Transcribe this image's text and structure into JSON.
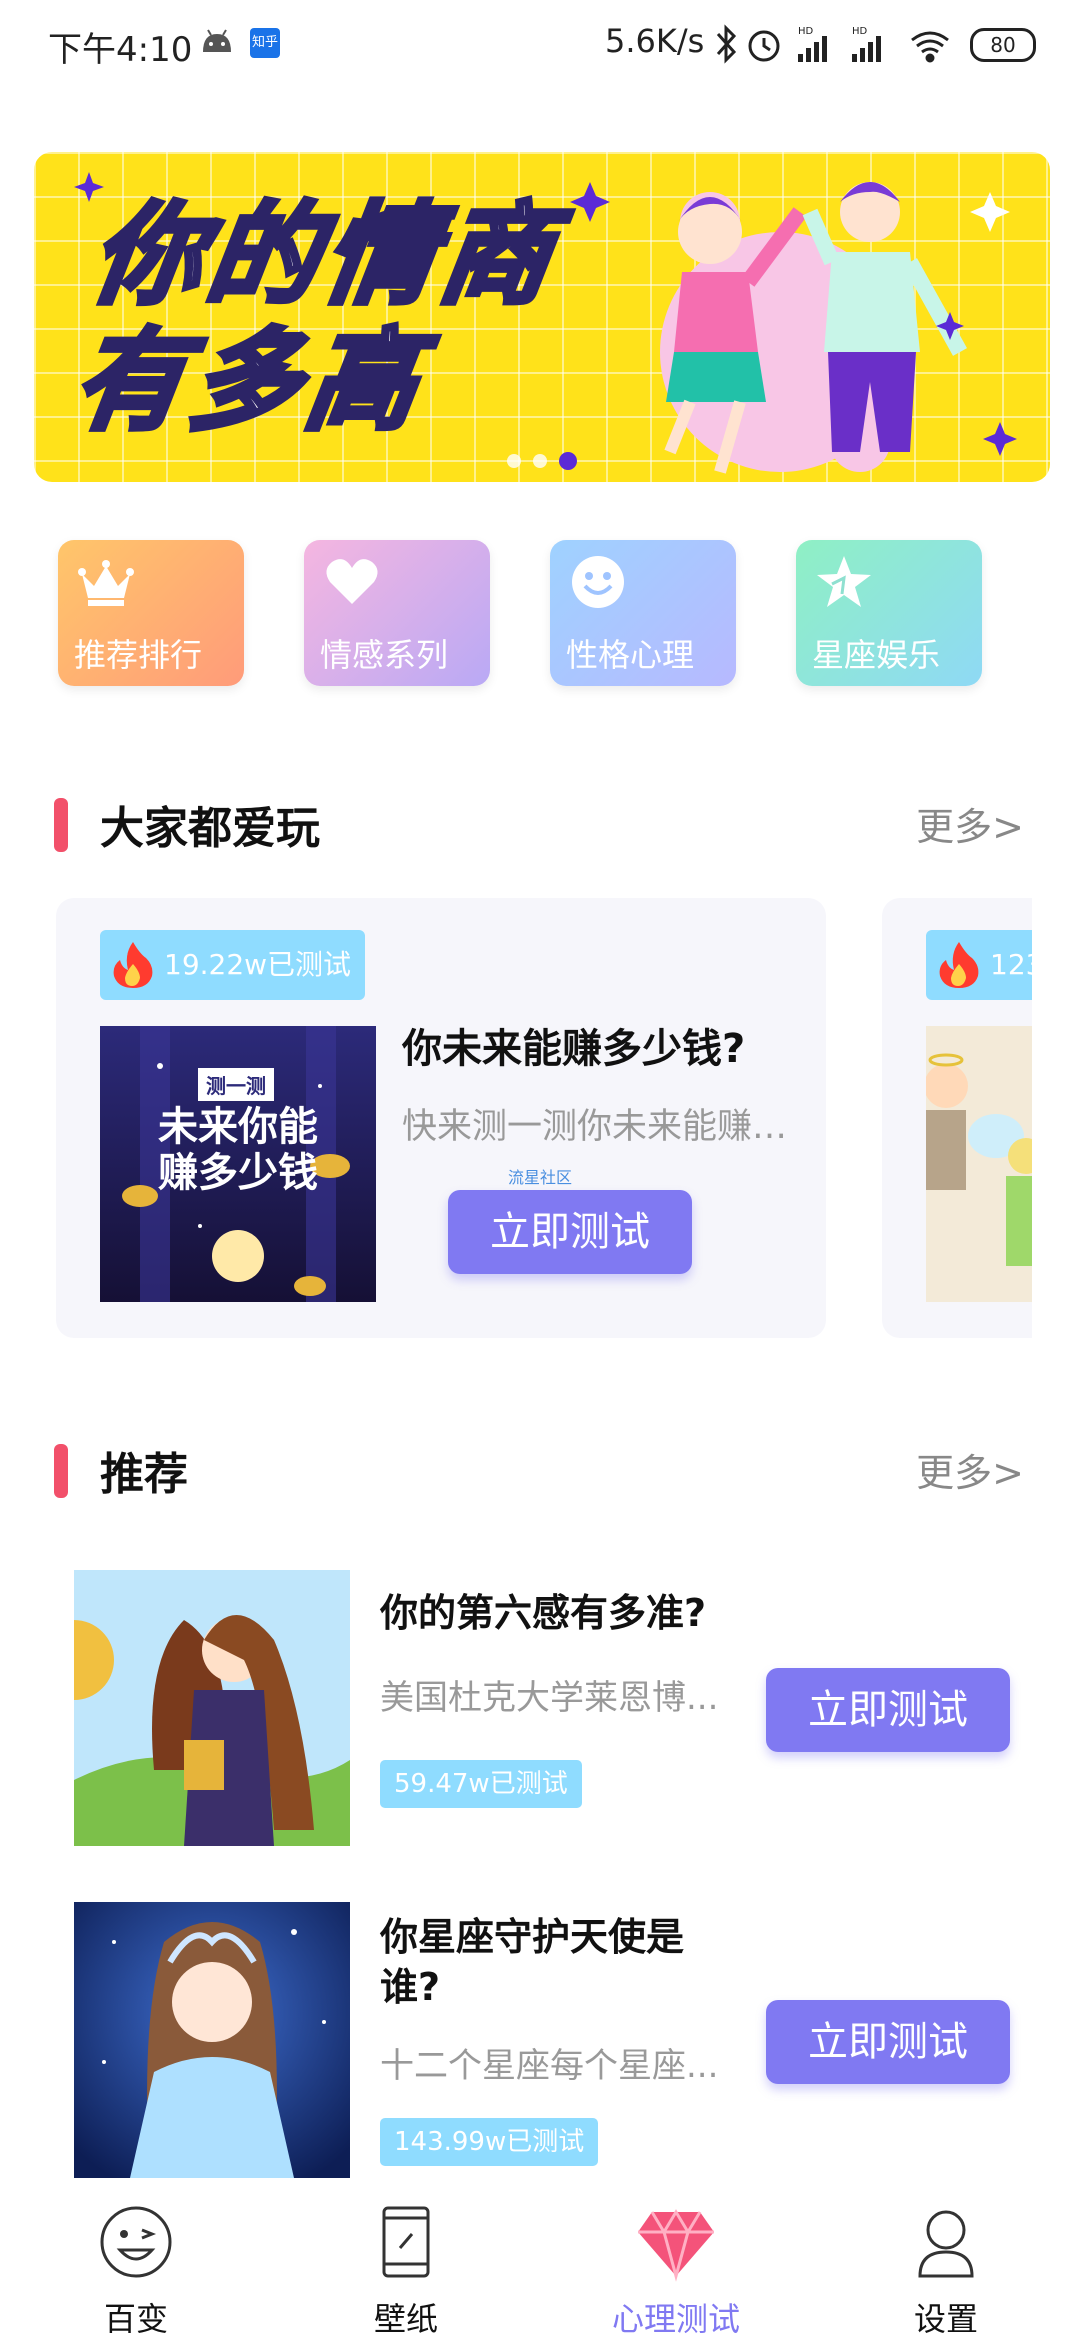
{
  "status_bar": {
    "time": "下午4:10",
    "zhihu_badge": "知乎",
    "net_speed": "5.6K/s",
    "battery": "80"
  },
  "banner": {
    "title_line1": "你的情商",
    "title_line2": "有多高",
    "page_count": 3,
    "active_page": 3
  },
  "categories": [
    {
      "label": "推荐排行",
      "icon": "crown-icon",
      "color_from": "#ffc66a",
      "color_to": "#ff9b7a"
    },
    {
      "label": "情感系列",
      "icon": "heart-icon",
      "color_from": "#f5b6e0",
      "color_to": "#b9a9f5"
    },
    {
      "label": "性格心理",
      "icon": "smile-icon",
      "color_from": "#9fd2ff",
      "color_to": "#b7b9ff"
    },
    {
      "label": "星座娱乐",
      "icon": "star-icon",
      "color_from": "#8ff0c4",
      "color_to": "#8fd9f5"
    }
  ],
  "popular": {
    "title": "大家都爱玩",
    "more": "更多>",
    "card": {
      "tested": "19.22w已测试",
      "image_text_badge": "测一测",
      "image_text_line1": "未来你能",
      "image_text_line2": "赚多少钱",
      "title": "你未来能赚多少钱?",
      "desc": "快来测一测你未来能赚多...",
      "watermark": "流星社区",
      "button": "立即测试"
    },
    "card2": {
      "tested_partial": "123"
    }
  },
  "recommended": {
    "title": "推荐",
    "more": "更多>",
    "items": [
      {
        "title": "你的第六感有多准?",
        "desc": "美国杜克大学莱恩博...",
        "tested": "59.47w已测试",
        "button": "立即测试"
      },
      {
        "title": "你星座守护天使是谁?",
        "desc": "十二个星座每个星座...",
        "tested": "143.99w已测试",
        "button": "立即测试"
      }
    ]
  },
  "bottom_nav": {
    "items": [
      {
        "label": "百变",
        "icon": "face-icon"
      },
      {
        "label": "壁纸",
        "icon": "phone-icon"
      },
      {
        "label": "心理测试",
        "icon": "diamond-icon"
      },
      {
        "label": "设置",
        "icon": "user-icon"
      }
    ],
    "active": "心理测试"
  },
  "colors": {
    "accent": "#8079f2",
    "section_bar": "#f2506a",
    "tag": "#8fdcff",
    "banner_bg": "#ffe21a"
  }
}
